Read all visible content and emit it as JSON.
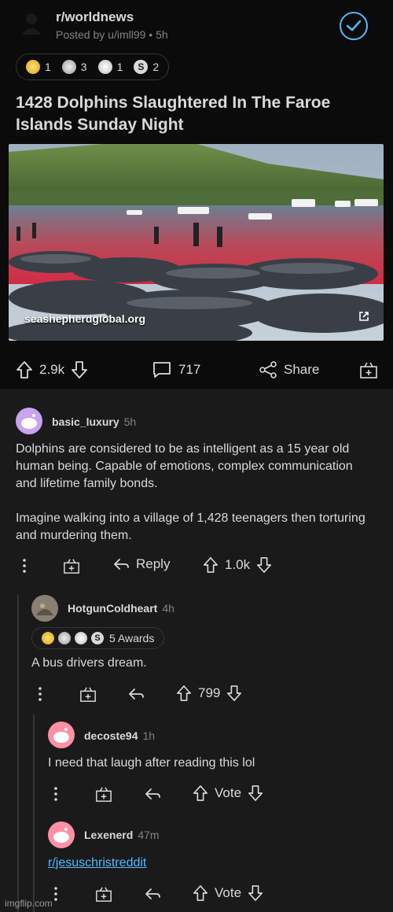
{
  "post": {
    "subreddit": "r/worldnews",
    "posted_by": "Posted by u/imll99 • 5h",
    "awards": [
      {
        "icon": "silver-award-icon",
        "count": "1",
        "color": "#f0c330"
      },
      {
        "icon": "wholesome-seal-icon",
        "count": "3",
        "color": "#c9c9c9"
      },
      {
        "icon": "helpful-face-icon",
        "count": "1",
        "color": "#e8e8e8"
      },
      {
        "icon": "s-badge-icon",
        "count": "2",
        "color": "#d7dadc"
      }
    ],
    "title": "1428 Dolphins Slaughtered In The Faroe Islands Sunday Night",
    "media_source": "seashepherdglobal.org",
    "upvotes": "2.9k",
    "comments": "717",
    "share_label": "Share"
  },
  "comments": [
    {
      "user": "basic_luxury",
      "time": "5h",
      "body_p1": "Dolphins are considered to be as intelligent as a 15 year old human being. Capable of emotions, complex communication and lifetime family bonds.",
      "body_p2": "Imagine walking into a village of 1,428 teenagers then torturing and murdering them.",
      "reply_label": "Reply",
      "votes": "1.0k",
      "avatar_color": "#c9a3ef"
    },
    {
      "user": "HotgunColdheart",
      "time": "4h",
      "awards_label": "5 Awards",
      "body": "A bus drivers dream.",
      "votes": "799"
    },
    {
      "user": "decoste94",
      "time": "1h",
      "body": "I need that laugh after reading this lol",
      "votes": "Vote",
      "avatar_color": "#ff8fa6"
    },
    {
      "user": "Lexenerd",
      "time": "47m",
      "body_link": "r/jesuschristreddit",
      "votes": "Vote",
      "avatar_color": "#ff8fa6"
    }
  ],
  "watermark": "imgflip.com",
  "colors": {
    "background": "#0b0b0b",
    "comment_bg": "#1a1a1b",
    "accent_blue": "#4fbcff",
    "text": "#d7dadc",
    "muted": "#818384"
  }
}
